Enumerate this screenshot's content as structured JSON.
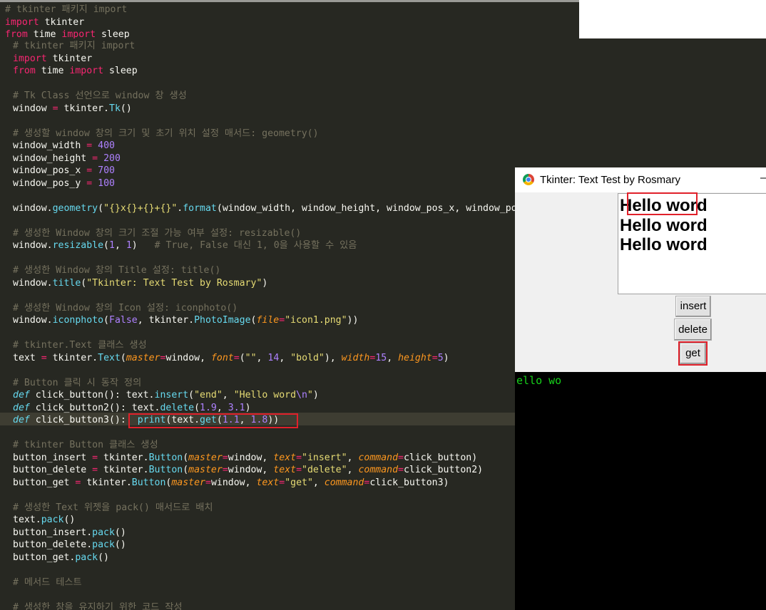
{
  "editor_back": {
    "lines": [
      [
        [
          "# tkinter 패키지 import",
          "cmt"
        ]
      ],
      [
        [
          "import",
          "kw"
        ],
        [
          " tkinter",
          ""
        ]
      ],
      [
        [
          "from",
          "kw"
        ],
        [
          " time ",
          ""
        ],
        [
          "import",
          "kw"
        ],
        [
          " sleep",
          ""
        ]
      ]
    ]
  },
  "editor_front": {
    "lines": [
      [
        [
          "# tkinter 패키지 import",
          "cmt"
        ]
      ],
      [
        [
          "import",
          "kw"
        ],
        [
          " tkinter",
          ""
        ]
      ],
      [
        [
          "from",
          "kw"
        ],
        [
          " time ",
          ""
        ],
        [
          "import",
          "kw"
        ],
        [
          " sleep",
          ""
        ]
      ],
      [],
      [
        [
          "# Tk Class 선언으로 window 창 생성",
          "cmt"
        ]
      ],
      [
        [
          "window ",
          ""
        ],
        [
          "=",
          "kw"
        ],
        [
          " tkinter.",
          ""
        ],
        [
          "Tk",
          "fn"
        ],
        [
          "()",
          ""
        ]
      ],
      [],
      [
        [
          "# 생성할 window 창의 크기 및 초기 위치 설정 매서드: geometry()",
          "cmt"
        ]
      ],
      [
        [
          "window_width ",
          ""
        ],
        [
          "=",
          "kw"
        ],
        [
          " ",
          ""
        ],
        [
          "400",
          "num"
        ]
      ],
      [
        [
          "window_height ",
          ""
        ],
        [
          "=",
          "kw"
        ],
        [
          " ",
          ""
        ],
        [
          "200",
          "num"
        ]
      ],
      [
        [
          "window_pos_x ",
          ""
        ],
        [
          "=",
          "kw"
        ],
        [
          " ",
          ""
        ],
        [
          "700",
          "num"
        ]
      ],
      [
        [
          "window_pos_y ",
          ""
        ],
        [
          "=",
          "kw"
        ],
        [
          " ",
          ""
        ],
        [
          "100",
          "num"
        ]
      ],
      [],
      [
        [
          "window.",
          ""
        ],
        [
          "geometry",
          "fn"
        ],
        [
          "(",
          ""
        ],
        [
          "\"{}x{}+{}+{}\"",
          "str"
        ],
        [
          ".",
          ""
        ],
        [
          "format",
          "fn"
        ],
        [
          "(window_width, window_height, window_pos_x, window_pos_y))",
          ""
        ]
      ],
      [],
      [
        [
          "# 생성한 Window 창의 크기 조절 가능 여부 설정: resizable()",
          "cmt"
        ]
      ],
      [
        [
          "window.",
          ""
        ],
        [
          "resizable",
          "fn"
        ],
        [
          "(",
          ""
        ],
        [
          "1",
          "num"
        ],
        [
          ", ",
          ""
        ],
        [
          "1",
          "num"
        ],
        [
          ")   ",
          ""
        ],
        [
          "# True, False 대신 1, 0을 사용할 수 있음",
          "cmt"
        ]
      ],
      [],
      [
        [
          "# 생성한 Window 창의 Title 설정: title()",
          "cmt"
        ]
      ],
      [
        [
          "window.",
          ""
        ],
        [
          "title",
          "fn"
        ],
        [
          "(",
          ""
        ],
        [
          "\"Tkinter: Text Test by Rosmary\"",
          "str"
        ],
        [
          ")",
          ""
        ]
      ],
      [],
      [
        [
          "# 생성한 Window 창의 Icon 설정: iconphoto()",
          "cmt"
        ]
      ],
      [
        [
          "window.",
          ""
        ],
        [
          "iconphoto",
          "fn"
        ],
        [
          "(",
          ""
        ],
        [
          "False",
          "num"
        ],
        [
          ", tkinter.",
          ""
        ],
        [
          "PhotoImage",
          "fn"
        ],
        [
          "(",
          ""
        ],
        [
          "file",
          "param"
        ],
        [
          "=",
          "kw"
        ],
        [
          "\"icon1.png\"",
          "str"
        ],
        [
          "))",
          ""
        ]
      ],
      [],
      [
        [
          "# tkinter.Text 클래스 생성",
          "cmt"
        ]
      ],
      [
        [
          "text ",
          ""
        ],
        [
          "=",
          "kw"
        ],
        [
          " tkinter.",
          ""
        ],
        [
          "Text",
          "fn"
        ],
        [
          "(",
          ""
        ],
        [
          "master",
          "param"
        ],
        [
          "=",
          "kw"
        ],
        [
          "window, ",
          ""
        ],
        [
          "font",
          "param"
        ],
        [
          "=",
          "kw"
        ],
        [
          "(",
          ""
        ],
        [
          "\"\"",
          "str"
        ],
        [
          ", ",
          ""
        ],
        [
          "14",
          "num"
        ],
        [
          ", ",
          ""
        ],
        [
          "\"bold\"",
          "str"
        ],
        [
          "), ",
          ""
        ],
        [
          "width",
          "param"
        ],
        [
          "=",
          "kw"
        ],
        [
          "15",
          "num"
        ],
        [
          ", ",
          ""
        ],
        [
          "height",
          "param"
        ],
        [
          "=",
          "kw"
        ],
        [
          "5",
          "num"
        ],
        [
          ")",
          ""
        ]
      ],
      [],
      [
        [
          "# Button 클릭 시 동작 정의",
          "cmt"
        ]
      ],
      [
        [
          "def",
          "def"
        ],
        [
          " click_button(): text.",
          ""
        ],
        [
          "insert",
          "fn"
        ],
        [
          "(",
          ""
        ],
        [
          "\"end\"",
          "str"
        ],
        [
          ", ",
          ""
        ],
        [
          "\"Hello word",
          "str"
        ],
        [
          "\\n",
          "esc"
        ],
        [
          "\"",
          "str"
        ],
        [
          ")",
          ""
        ]
      ],
      [
        [
          "def",
          "def"
        ],
        [
          " click_button2(): text.",
          ""
        ],
        [
          "delete",
          "fn"
        ],
        [
          "(",
          ""
        ],
        [
          "1.9",
          "num"
        ],
        [
          ", ",
          ""
        ],
        [
          "3.1",
          "num"
        ],
        [
          ")",
          ""
        ]
      ],
      [
        [
          "def",
          "def"
        ],
        [
          " click_button3():  ",
          ""
        ],
        [
          "print",
          "fn"
        ],
        [
          "(text.",
          ""
        ],
        [
          "get",
          "fn"
        ],
        [
          "(",
          ""
        ],
        [
          "1.1",
          "num"
        ],
        [
          ", ",
          ""
        ],
        [
          "1.8",
          "num"
        ],
        [
          "))",
          ""
        ]
      ],
      [],
      [
        [
          "# tkinter Button 클래스 생성",
          "cmt"
        ]
      ],
      [
        [
          "button_insert ",
          ""
        ],
        [
          "=",
          "kw"
        ],
        [
          " tkinter.",
          ""
        ],
        [
          "Button",
          "fn"
        ],
        [
          "(",
          ""
        ],
        [
          "master",
          "param"
        ],
        [
          "=",
          "kw"
        ],
        [
          "window, ",
          ""
        ],
        [
          "text",
          "param"
        ],
        [
          "=",
          "kw"
        ],
        [
          "\"insert\"",
          "str"
        ],
        [
          ", ",
          ""
        ],
        [
          "command",
          "param"
        ],
        [
          "=",
          "kw"
        ],
        [
          "click_button)",
          ""
        ]
      ],
      [
        [
          "button_delete ",
          ""
        ],
        [
          "=",
          "kw"
        ],
        [
          " tkinter.",
          ""
        ],
        [
          "Button",
          "fn"
        ],
        [
          "(",
          ""
        ],
        [
          "master",
          "param"
        ],
        [
          "=",
          "kw"
        ],
        [
          "window, ",
          ""
        ],
        [
          "text",
          "param"
        ],
        [
          "=",
          "kw"
        ],
        [
          "\"delete\"",
          "str"
        ],
        [
          ", ",
          ""
        ],
        [
          "command",
          "param"
        ],
        [
          "=",
          "kw"
        ],
        [
          "click_button2)",
          ""
        ]
      ],
      [
        [
          "button_get ",
          ""
        ],
        [
          "=",
          "kw"
        ],
        [
          " tkinter.",
          ""
        ],
        [
          "Button",
          "fn"
        ],
        [
          "(",
          ""
        ],
        [
          "master",
          "param"
        ],
        [
          "=",
          "kw"
        ],
        [
          "window, ",
          ""
        ],
        [
          "text",
          "param"
        ],
        [
          "=",
          "kw"
        ],
        [
          "\"get\"",
          "str"
        ],
        [
          ", ",
          ""
        ],
        [
          "command",
          "param"
        ],
        [
          "=",
          "kw"
        ],
        [
          "click_button3)",
          ""
        ]
      ],
      [],
      [
        [
          "# 생성한 Text 위젯을 pack() 매서드로 배치",
          "cmt"
        ]
      ],
      [
        [
          "text.",
          ""
        ],
        [
          "pack",
          "fn"
        ],
        [
          "()",
          ""
        ]
      ],
      [
        [
          "button_insert.",
          ""
        ],
        [
          "pack",
          "fn"
        ],
        [
          "()",
          ""
        ]
      ],
      [
        [
          "button_delete.",
          ""
        ],
        [
          "pack",
          "fn"
        ],
        [
          "()",
          ""
        ]
      ],
      [
        [
          "button_get.",
          ""
        ],
        [
          "pack",
          "fn"
        ],
        [
          "()",
          ""
        ]
      ],
      [],
      [
        [
          "# 메서드 테스트",
          "cmt"
        ]
      ],
      [],
      [
        [
          "# 생성한 창을 유지하기 위한 코드 작성",
          "cmt"
        ]
      ]
    ]
  },
  "tk_window": {
    "title": "Tkinter: Text Test by Rosmary",
    "minimize_glyph": "–",
    "text_lines": [
      "Hello word",
      "Hello word",
      "Hello word"
    ],
    "buttons": {
      "insert": "insert",
      "delete": "delete",
      "get": "get"
    }
  },
  "terminal": {
    "output": "ello wo"
  },
  "colors": {
    "editor_bg": "#272822",
    "highlight": "#e0202a",
    "terminal_text": "#17d21b"
  }
}
